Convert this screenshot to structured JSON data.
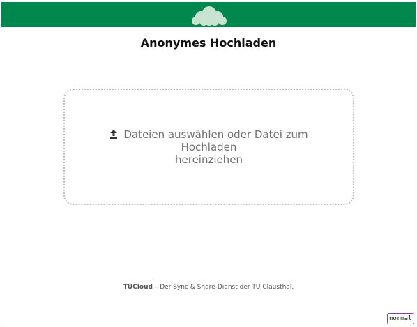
{
  "header": {
    "bar_color": "#00874d",
    "logo_icon": "cloud-logo-icon"
  },
  "page": {
    "title": "Anonymes Hochladen"
  },
  "upload": {
    "icon": "upload-icon",
    "text_line1": "Dateien auswählen oder Datei zum Hochladen",
    "text_line2": "hereinziehen"
  },
  "footer": {
    "brand": "TUCloud",
    "text": " – Der Sync & Share-Dienst der TU Clausthal."
  },
  "badge": {
    "mode": "normal"
  }
}
